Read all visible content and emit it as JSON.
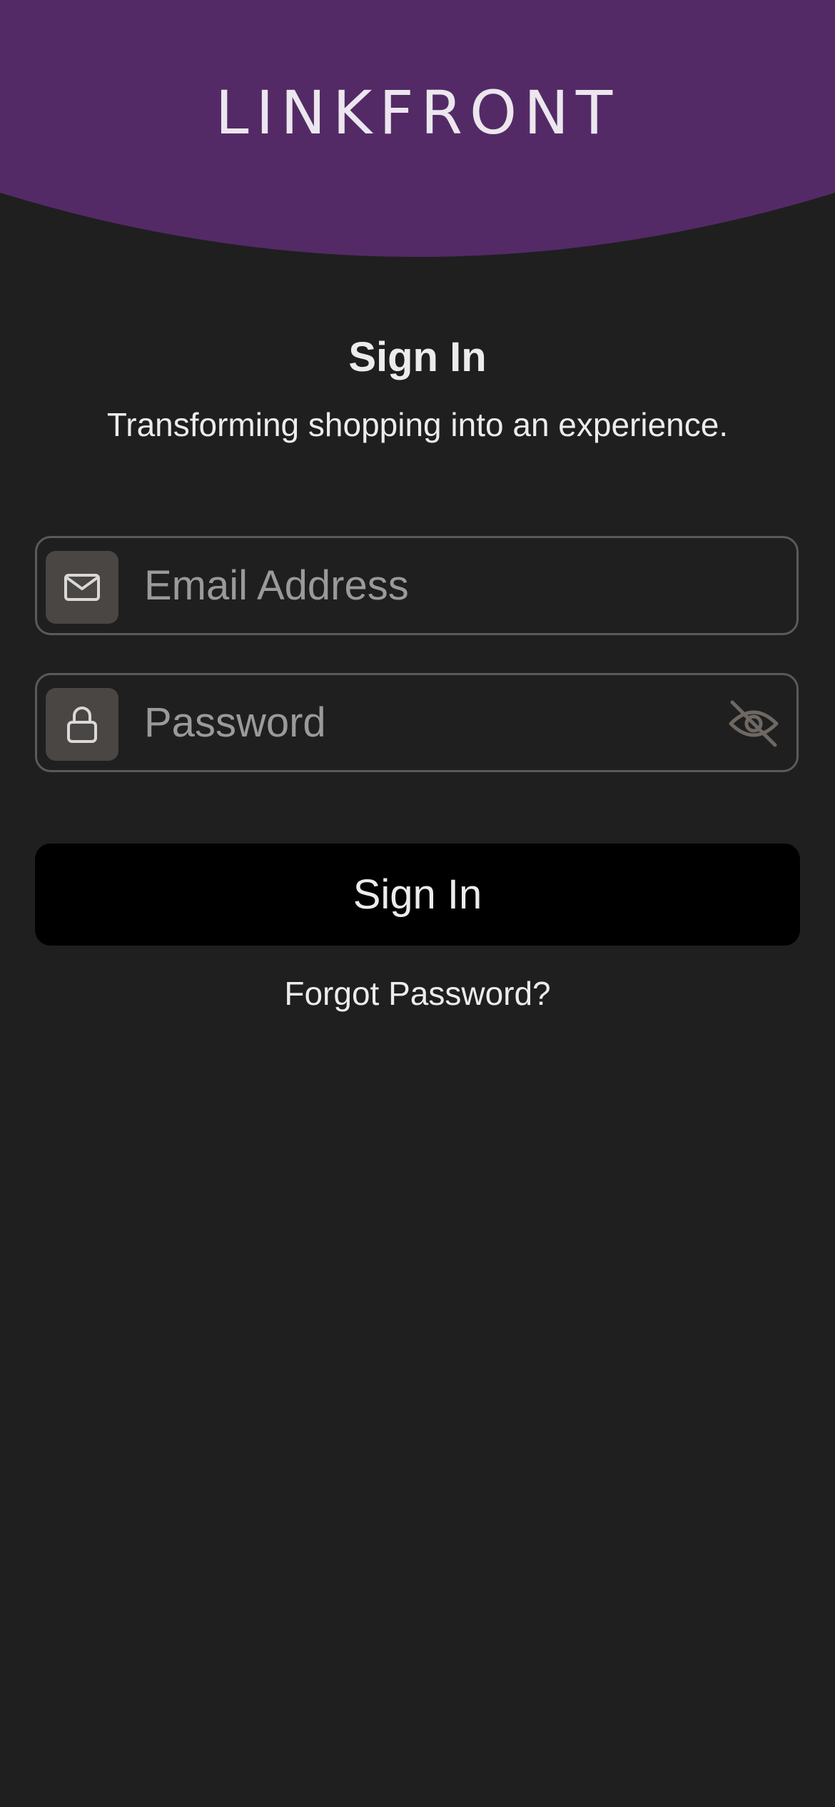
{
  "brand": {
    "logo_text": "LINKFRONT",
    "header_color": "#532a66"
  },
  "signin": {
    "title": "Sign In",
    "subtitle": "Transforming shopping into an experience.",
    "email": {
      "placeholder": "Email Address",
      "value": "",
      "icon": "envelope-icon"
    },
    "password": {
      "placeholder": "Password",
      "value": "",
      "icon": "lock-icon",
      "toggle_icon": "eye-off-icon"
    },
    "submit_label": "Sign In",
    "forgot_label": "Forgot Password?"
  }
}
